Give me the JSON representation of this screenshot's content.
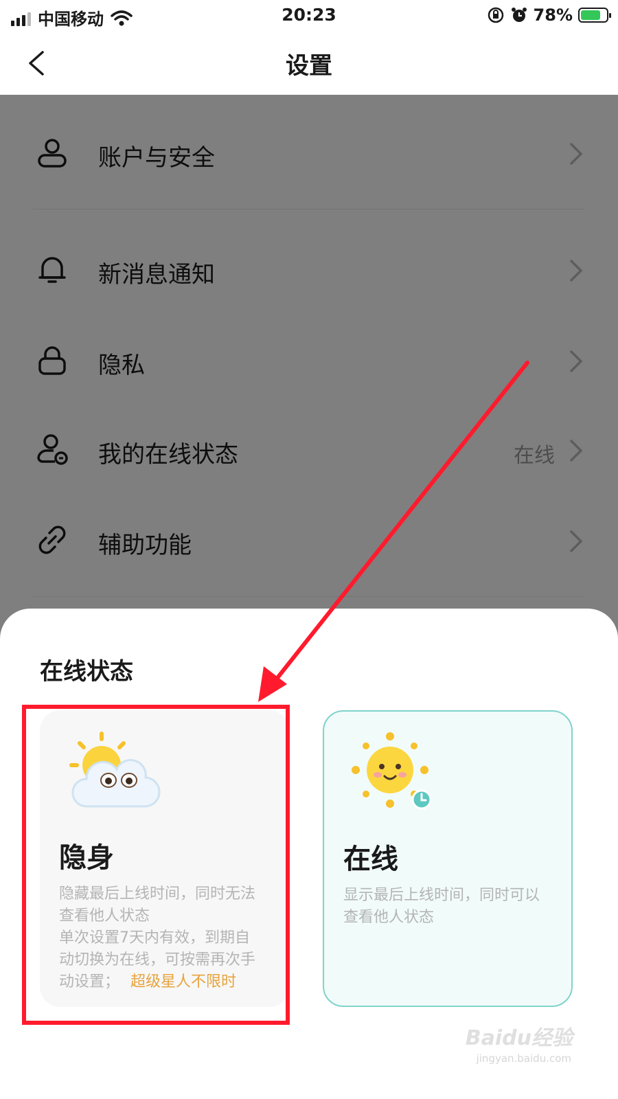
{
  "status_bar": {
    "carrier": "中国移动",
    "time": "20:23",
    "battery": "78%",
    "battery_level": 0.78
  },
  "nav": {
    "title": "设置"
  },
  "settings": [
    {
      "label": "账户与安全",
      "value": "",
      "icon": "user-icon"
    },
    {
      "label": "新消息通知",
      "value": "",
      "icon": "bell-icon"
    },
    {
      "label": "隐私",
      "value": "",
      "icon": "lock-icon"
    },
    {
      "label": "我的在线状态",
      "value": "在线",
      "icon": "user-status-icon"
    },
    {
      "label": "辅助功能",
      "value": "",
      "icon": "link-icon"
    }
  ],
  "sheet": {
    "title": "在线状态",
    "options": [
      {
        "name": "隐身",
        "desc_lines": [
          "隐藏最后上线时间，同时无法",
          "查看他人状态"
        ],
        "extra_lines": [
          "单次设置7天内有效，到期自",
          "动切换为在线，可按需再次手"
        ],
        "extra_last": "动设置；",
        "vip": "超级星人不限时",
        "icon": "sun-cloud-emoji-icon"
      },
      {
        "name": "在线",
        "desc_lines": [
          "显示最后上线时间，同时可以",
          "查看他人状态"
        ],
        "icon": "sun-emoji-icon"
      }
    ]
  },
  "watermark": {
    "brand": "Baidu经验",
    "url": "jingyan.baidu.com"
  },
  "colors": {
    "highlight": "#ff1b2d",
    "online_border": "#7fd3cb",
    "vip": "#e8a33d"
  }
}
